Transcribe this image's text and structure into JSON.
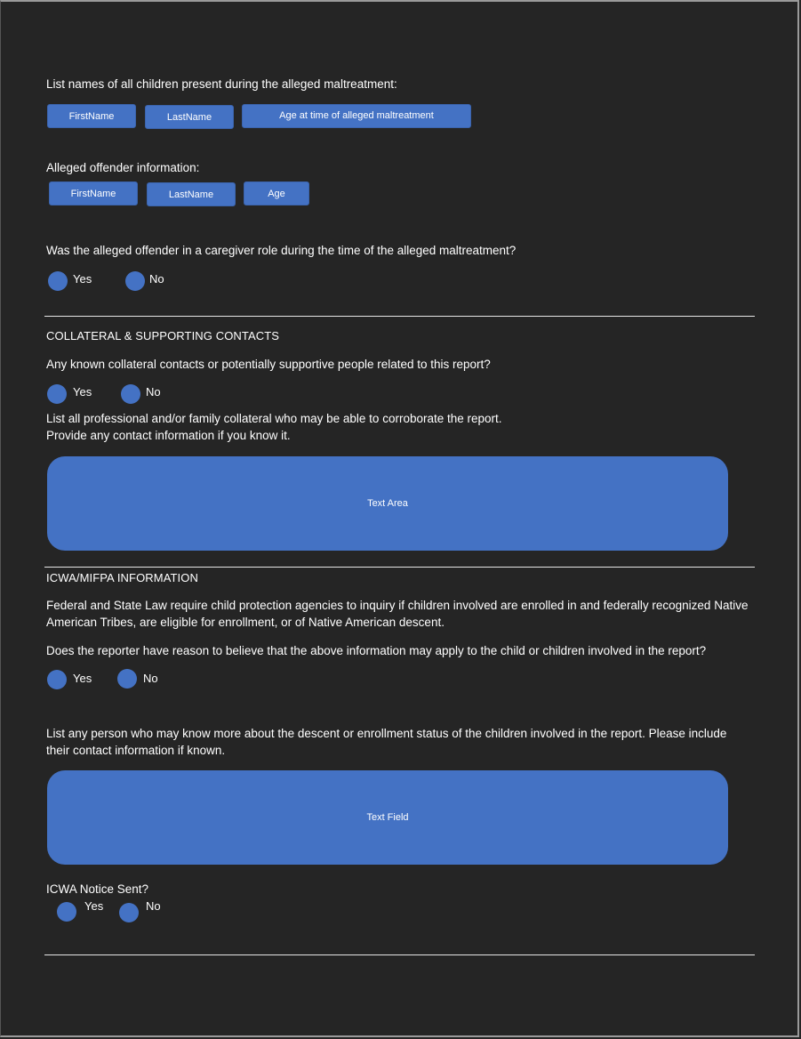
{
  "colors": {
    "background": "#252525",
    "accent": "#4472c4",
    "text": "#ffffff",
    "divider": "#e6e6e6"
  },
  "children": {
    "label": "List names of all children present during the alleged maltreatment:",
    "fields": [
      "FirstName",
      "LastName",
      "Age at time of alleged maltreatment"
    ]
  },
  "offender": {
    "label": "Alleged offender information:",
    "fields": [
      "FirstName",
      "LastName",
      "Age"
    ]
  },
  "caregiver": {
    "question": "Was the alleged offender in a caregiver role during the time of the alleged maltreatment?",
    "options": [
      "Yes",
      "No"
    ]
  },
  "collateral": {
    "title": "COLLATERAL & SUPPORTING CONTACTS",
    "question": "Any known collateral contacts or potentially supportive people related to this report?",
    "options": [
      "Yes",
      "No"
    ],
    "instruction_line1": "List all professional and/or family collateral who may be able to corroborate the report.",
    "instruction_line2": "Provide any contact information if you know it.",
    "textarea_placeholder": "Text Area"
  },
  "icwa": {
    "title": "ICWA/MIFPA INFORMATION",
    "law_text": "Federal and State Law require child protection agencies to inquiry if children involved are enrolled in and federally recognized Native American Tribes, are eligible for enrollment, or of Native American descent.",
    "question": "Does the reporter have reason to believe that the above information may apply to the child or children involved in the report?",
    "options": [
      "Yes",
      "No"
    ],
    "list_instruction": "List any person who may know more about the descent or enrollment status of the children involved in the report. Please include their contact information if known.",
    "textfield_placeholder": "Text Field",
    "notice_label": "ICWA Notice Sent?",
    "notice_options": [
      "Yes",
      "No"
    ]
  }
}
